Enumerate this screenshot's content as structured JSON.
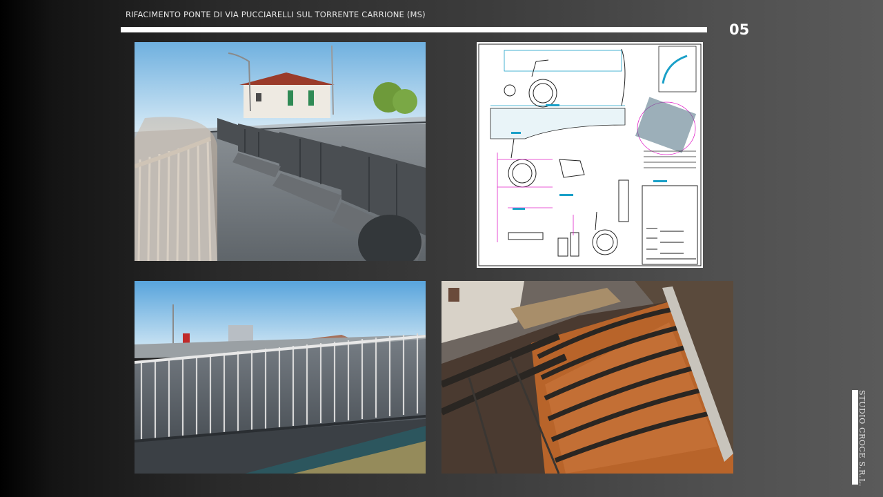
{
  "slide": {
    "title": "RIFACIMENTO  PONTE  DI VIA PUCCIARELLI SUL TORRENTE  CARRIONE (MS)",
    "page_number": "05",
    "studio_name": "STUDIO CROCE S.R.L."
  },
  "colors": {
    "title_rule": "#ffffff",
    "drawing_cyan": "#1aa0c8",
    "drawing_magenta": "#e020c8",
    "steel_rust": "#b86a2a"
  }
}
